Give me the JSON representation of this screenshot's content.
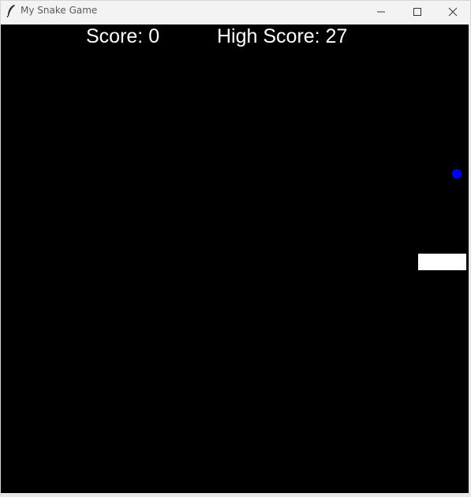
{
  "window": {
    "title": "My Snake Game",
    "app_icon": "feather-icon",
    "controls": {
      "minimize_icon": "minimize-icon",
      "maximize_icon": "maximize-icon",
      "close_icon": "close-icon"
    }
  },
  "game": {
    "score_text": "Score: 0",
    "high_score_text": "High Score: 27",
    "colors": {
      "background": "#000000",
      "snake": "#ffffff",
      "food": "#0000ff",
      "text": "#ffffff"
    }
  }
}
